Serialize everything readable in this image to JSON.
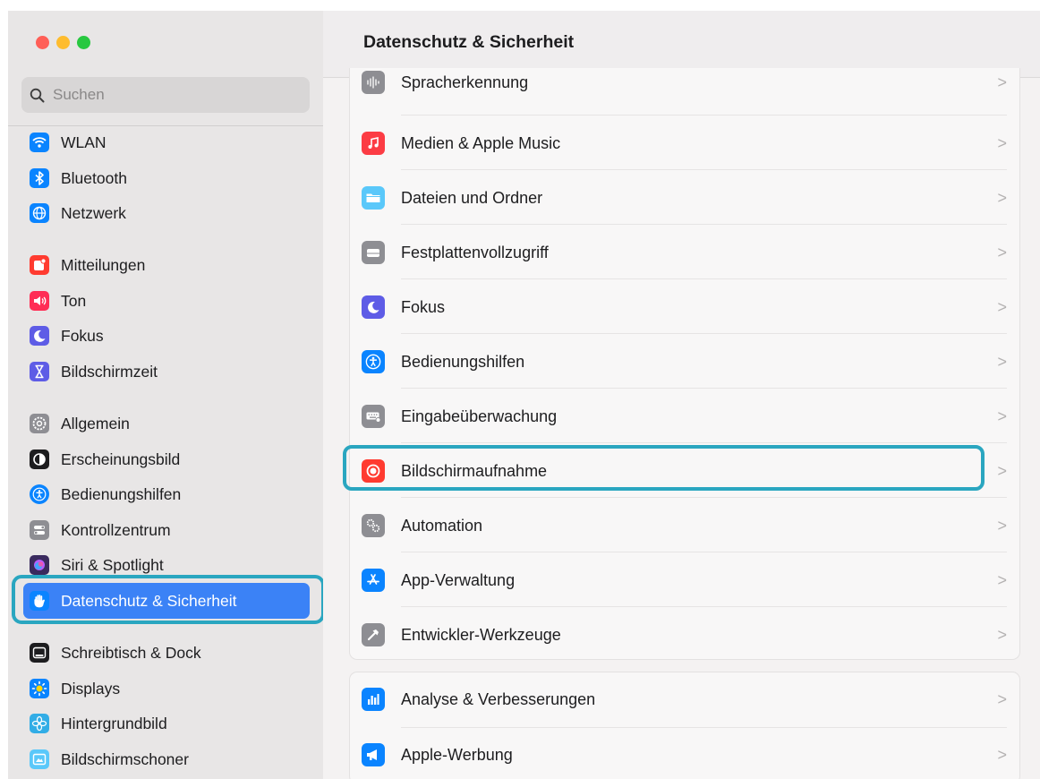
{
  "search": {
    "placeholder": "Suchen"
  },
  "sidebar": {
    "items": [
      {
        "label": "WLAN",
        "icon": "wifi-icon",
        "color": "#0a84ff"
      },
      {
        "label": "Bluetooth",
        "icon": "bluetooth-icon",
        "color": "#0a84ff"
      },
      {
        "label": "Netzwerk",
        "icon": "globe-icon",
        "color": "#0a84ff"
      },
      {
        "label": "Mitteilungen",
        "icon": "bell-icon",
        "color": "#ff3b30"
      },
      {
        "label": "Ton",
        "icon": "speaker-icon",
        "color": "#ff2d55"
      },
      {
        "label": "Fokus",
        "icon": "moon-icon",
        "color": "#5e5ce6"
      },
      {
        "label": "Bildschirmzeit",
        "icon": "hourglass-icon",
        "color": "#5e5ce6"
      },
      {
        "label": "Allgemein",
        "icon": "gear-icon",
        "color": "#8e8e93"
      },
      {
        "label": "Erscheinungsbild",
        "icon": "appearance-icon",
        "color": "#1d1d1f"
      },
      {
        "label": "Bedienungshilfen",
        "icon": "accessibility-icon",
        "color": "#0a84ff"
      },
      {
        "label": "Kontrollzentrum",
        "icon": "toggles-icon",
        "color": "#8e8e93"
      },
      {
        "label": "Siri & Spotlight",
        "icon": "siri-icon",
        "color": "#3a2a5e"
      },
      {
        "label": "Datenschutz & Sicherheit",
        "icon": "hand-icon",
        "color": "#0a84ff"
      },
      {
        "label": "Schreibtisch & Dock",
        "icon": "dock-icon",
        "color": "#1d1d1f"
      },
      {
        "label": "Displays",
        "icon": "sun-icon",
        "color": "#0a84ff"
      },
      {
        "label": "Hintergrundbild",
        "icon": "flower-icon",
        "color": "#32ade6"
      },
      {
        "label": "Bildschirmschoner",
        "icon": "screensaver-icon",
        "color": "#5ac8fa"
      }
    ],
    "selected": "Datenschutz & Sicherheit"
  },
  "main": {
    "title": "Datenschutz & Sicherheit",
    "group1": [
      {
        "label": "Spracherkennung",
        "icon": "waveform-icon",
        "color": "#8e8e93"
      },
      {
        "label": "Medien & Apple Music",
        "icon": "music-note-icon",
        "color": "#fc3c44"
      },
      {
        "label": "Dateien und Ordner",
        "icon": "folder-icon",
        "color": "#5ac8fa"
      },
      {
        "label": "Festplattenvollzugriff",
        "icon": "hard-drive-icon",
        "color": "#8e8e93"
      },
      {
        "label": "Fokus",
        "icon": "moon-icon",
        "color": "#5e5ce6"
      },
      {
        "label": "Bedienungshilfen",
        "icon": "accessibility-icon",
        "color": "#0a84ff"
      },
      {
        "label": "Eingabeüberwachung",
        "icon": "keyboard-icon",
        "color": "#8e8e93"
      },
      {
        "label": "Bildschirmaufnahme",
        "icon": "record-icon",
        "color": "#ff3b30"
      },
      {
        "label": "Automation",
        "icon": "gears-icon",
        "color": "#8e8e93"
      },
      {
        "label": "App-Verwaltung",
        "icon": "app-store-icon",
        "color": "#0a84ff"
      },
      {
        "label": "Entwickler-Werkzeuge",
        "icon": "hammer-icon",
        "color": "#8e8e93"
      }
    ],
    "group2": [
      {
        "label": "Analyse & Verbesserungen",
        "icon": "chart-icon",
        "color": "#0a84ff"
      },
      {
        "label": "Apple-Werbung",
        "icon": "megaphone-icon",
        "color": "#0a84ff"
      }
    ],
    "chevron": ">"
  }
}
